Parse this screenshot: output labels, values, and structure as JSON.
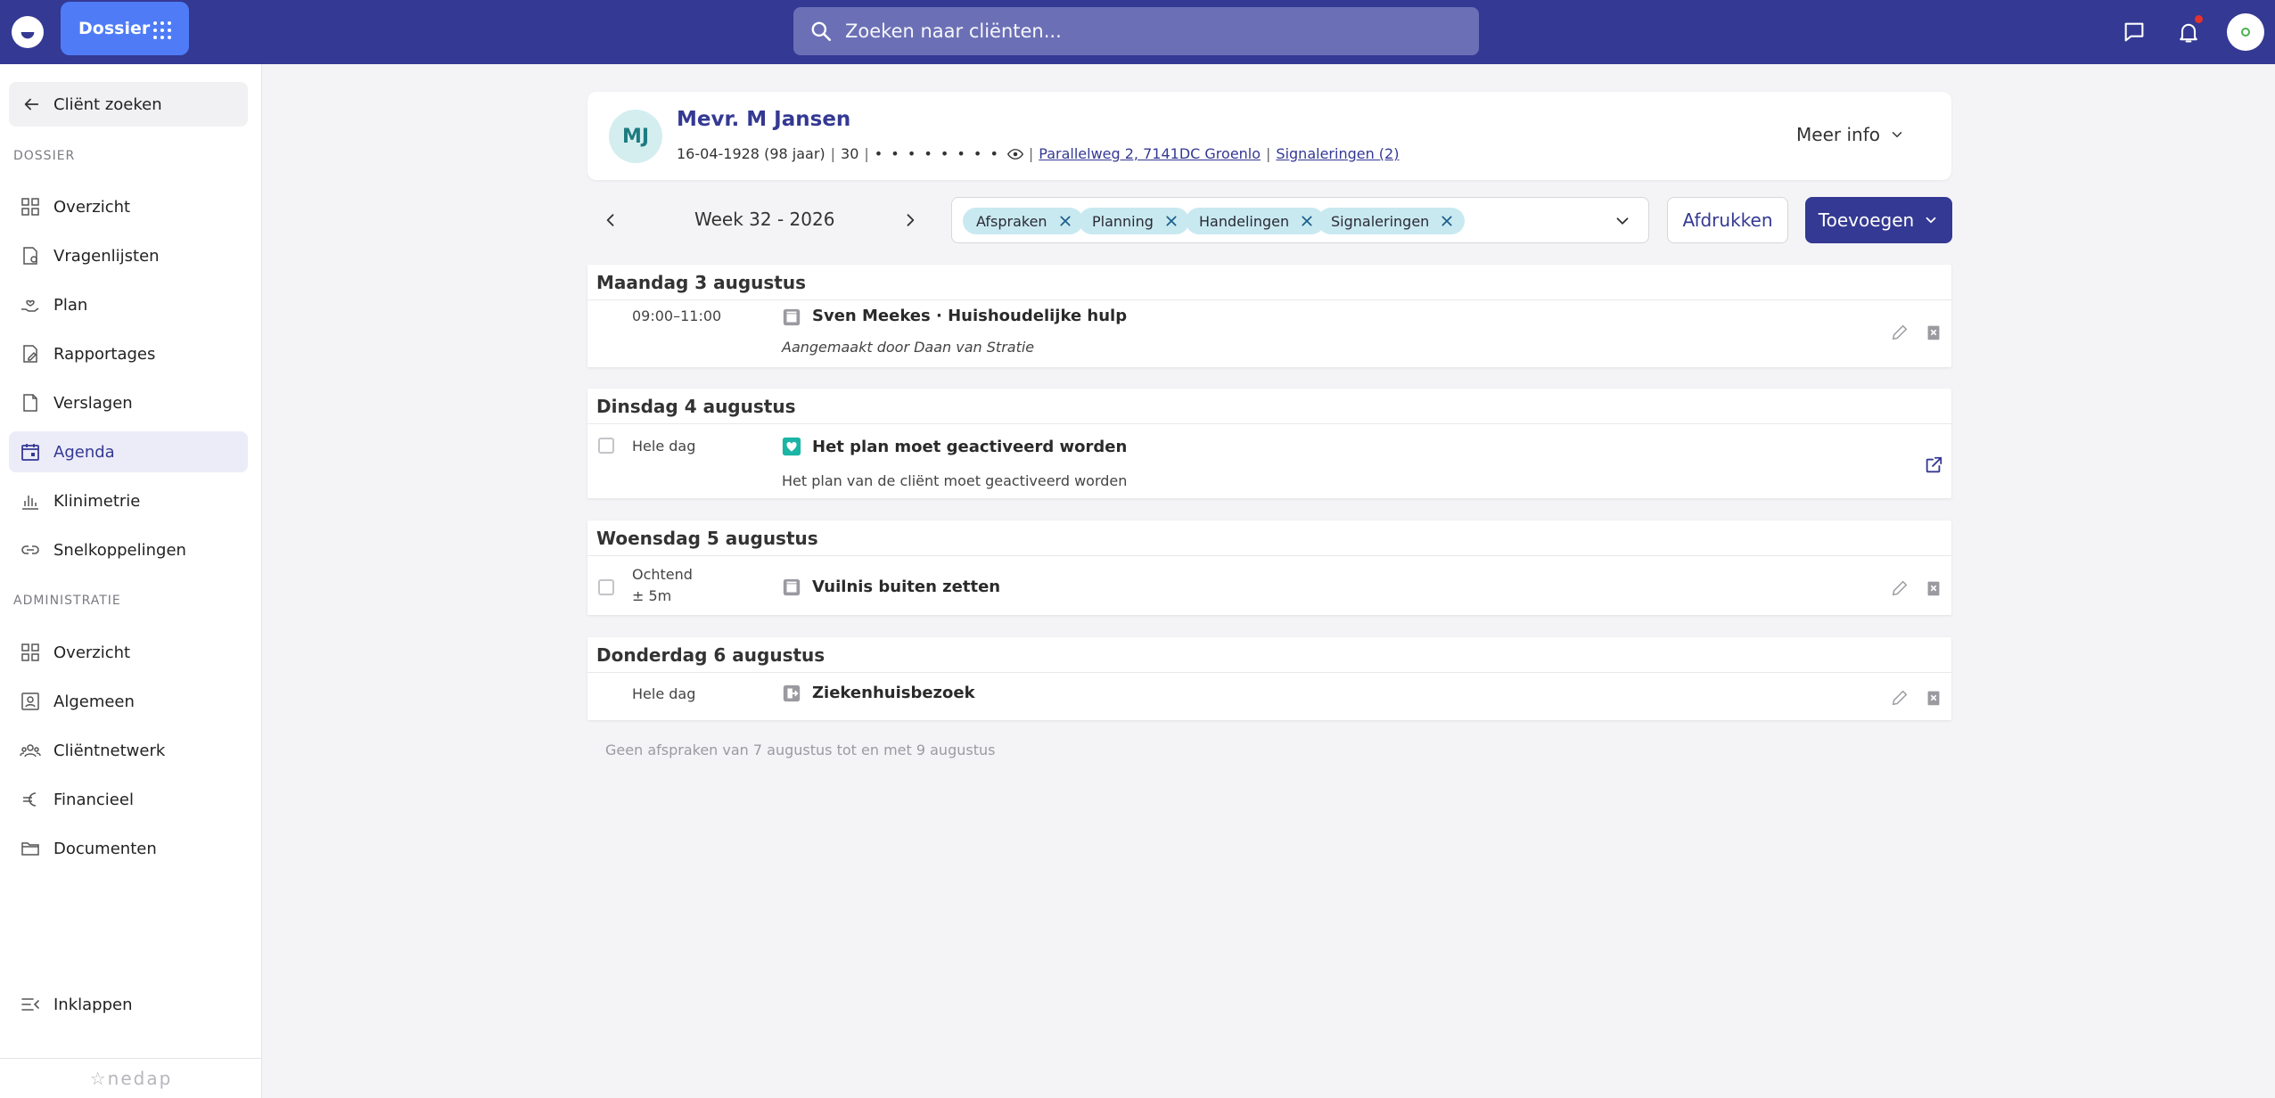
{
  "topbar": {
    "app_button": "Dossier",
    "search_placeholder": "Zoeken naar cliënten..."
  },
  "sidebar": {
    "back_label": "Cliënt zoeken",
    "dossier_section": "DOSSIER",
    "dossier_items": [
      {
        "label": "Overzicht",
        "icon": "grid-icon"
      },
      {
        "label": "Vragenlijsten",
        "icon": "questionnaire-icon"
      },
      {
        "label": "Plan",
        "icon": "plan-heart-icon"
      },
      {
        "label": "Rapportages",
        "icon": "report-edit-icon"
      },
      {
        "label": "Verslagen",
        "icon": "document-icon"
      },
      {
        "label": "Agenda",
        "icon": "calendar-icon",
        "active": true
      },
      {
        "label": "Klinimetrie",
        "icon": "bar-chart-icon"
      },
      {
        "label": "Snelkoppelingen",
        "icon": "link-icon"
      }
    ],
    "admin_section": "ADMINISTRATIE",
    "admin_items": [
      {
        "label": "Overzicht",
        "icon": "grid-icon"
      },
      {
        "label": "Algemeen",
        "icon": "id-card-icon"
      },
      {
        "label": "Cliëntnetwerk",
        "icon": "people-icon"
      },
      {
        "label": "Financieel",
        "icon": "euro-icon"
      },
      {
        "label": "Documenten",
        "icon": "folder-icon"
      }
    ],
    "collapse_label": "Inklappen",
    "brand": "nedap"
  },
  "client": {
    "initials": "MJ",
    "name": "Mevr. M Jansen",
    "birth": "16-04-1928 (98 jaar)",
    "number": "30",
    "masked": "• • • • • • • •",
    "address": "Parallelweg 2, 7141DC Groenlo",
    "signals": "Signaleringen (2)",
    "more_info": "Meer info"
  },
  "toolbar": {
    "week": "Week 32 - 2026",
    "chips": [
      "Afspraken",
      "Planning",
      "Handelingen",
      "Signaleringen"
    ],
    "print": "Afdrukken",
    "add": "Toevoegen"
  },
  "days": [
    {
      "header": "Maandag 3 augustus",
      "time": "09:00–11:00",
      "title": "Sven Meekes · Huishoudelijke hulp",
      "sub": "Aangemaakt door Daan van Stratie"
    },
    {
      "header": "Dinsdag 4 augustus",
      "time": "Hele dag",
      "title": "Het plan moet geactiveerd worden",
      "sub": "Het plan van de cliënt moet geactiveerd worden"
    },
    {
      "header": "Woensdag 5 augustus",
      "time": "Ochtend",
      "time2": "± 5m",
      "title": "Vuilnis buiten zetten"
    },
    {
      "header": "Donderdag 6 augustus",
      "time": "Hele dag",
      "title": "Ziekenhuisbezoek"
    }
  ],
  "empty_note": "Geen afspraken van 7 augustus tot en met 9 augustus"
}
